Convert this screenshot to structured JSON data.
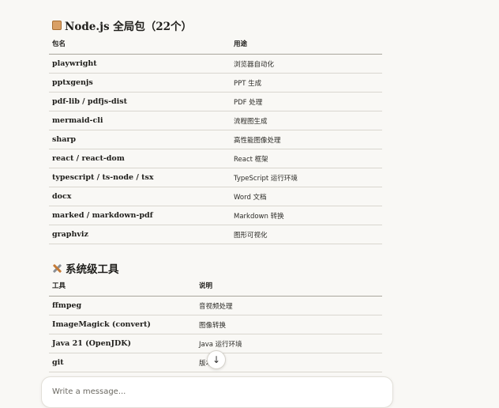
{
  "node_section": {
    "title": "Node.js 全局包（22个）",
    "icon": "package-icon",
    "headers": [
      "包名",
      "用途"
    ],
    "rows": [
      {
        "name": "playwright",
        "desc": "浏览器自动化"
      },
      {
        "name": "pptxgenjs",
        "desc": "PPT 生成"
      },
      {
        "name": "pdf-lib / pdfjs-dist",
        "desc": "PDF 处理"
      },
      {
        "name": "mermaid-cli",
        "desc": "流程图生成"
      },
      {
        "name": "sharp",
        "desc": "高性能图像处理"
      },
      {
        "name": "react / react-dom",
        "desc": "React 框架"
      },
      {
        "name": "typescript / ts-node / tsx",
        "desc": "TypeScript 运行环境"
      },
      {
        "name": "docx",
        "desc": "Word 文档"
      },
      {
        "name": "marked / markdown-pdf",
        "desc": "Markdown 转换"
      },
      {
        "name": "graphviz",
        "desc": "图形可视化"
      }
    ]
  },
  "system_section": {
    "title": "系统级工具",
    "icon": "hammer-wrench-icon",
    "headers": [
      "工具",
      "说明"
    ],
    "rows": [
      {
        "name": "ffmpeg",
        "desc": "音视频处理"
      },
      {
        "name": "ImageMagick (convert)",
        "desc": "图像转换"
      },
      {
        "name": "Java 21 (OpenJDK)",
        "desc": "Java 运行环境"
      },
      {
        "name": "git",
        "desc": "版本"
      }
    ]
  },
  "scroll_button": {
    "icon": "arrow-down-icon",
    "glyph": "↓"
  },
  "composer": {
    "placeholder": "Write a message..."
  }
}
